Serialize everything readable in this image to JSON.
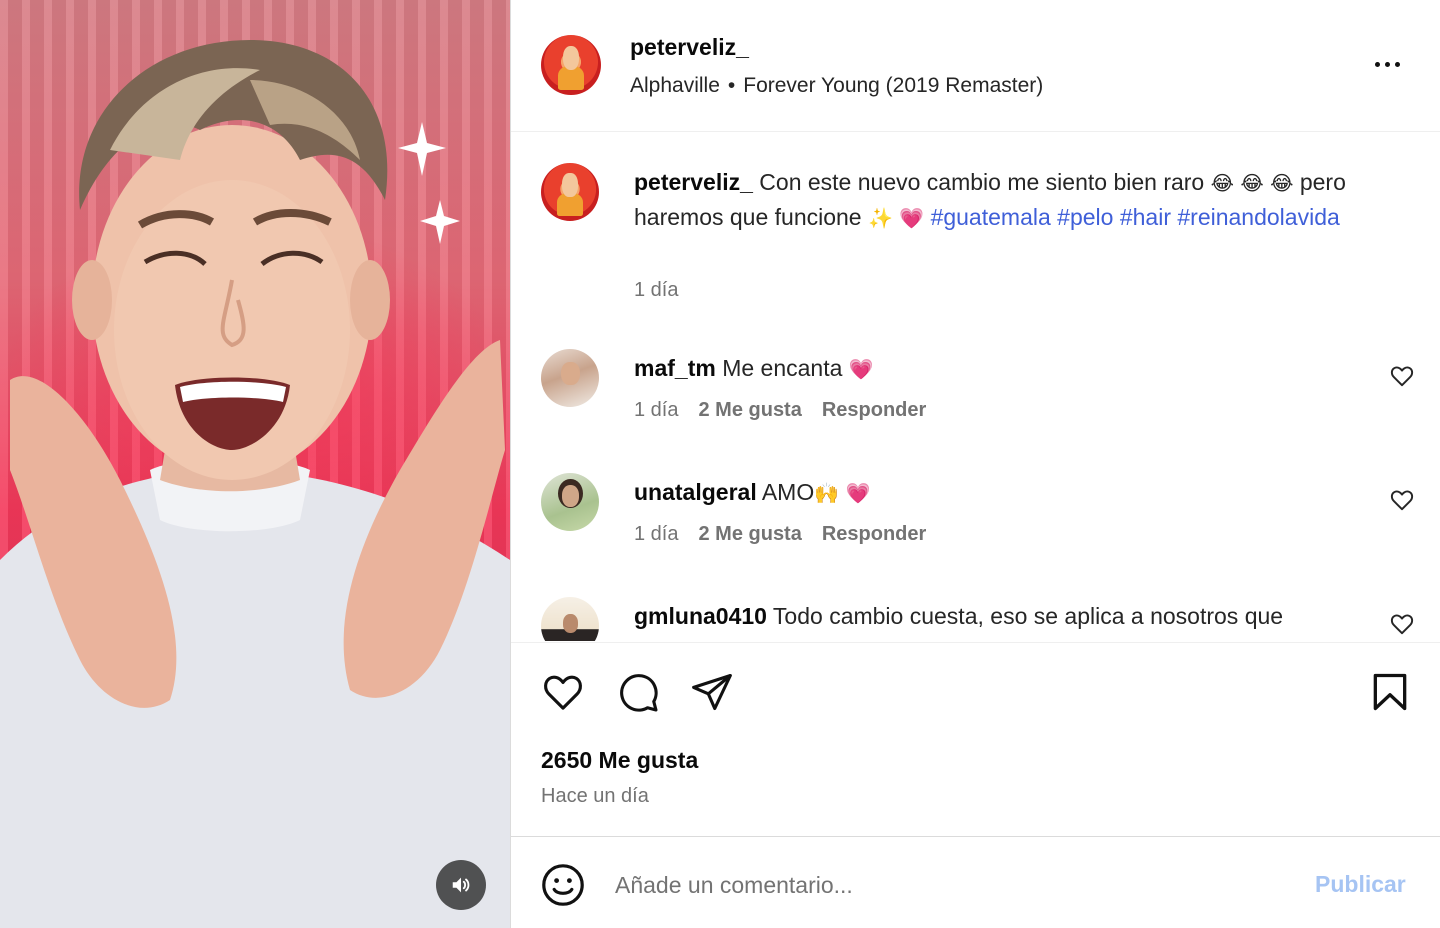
{
  "post": {
    "username": "peterveliz_",
    "music_artist": "Alphaville",
    "music_separator": "•",
    "music_track": "Forever Young (2019 Remaster)"
  },
  "caption": {
    "username": "peterveliz_",
    "text_part1": " Con este nuevo cambio me siento bien raro ",
    "emoji_laugh": "😂 😂 😂",
    "text_part2": " pero haremos que funcione ",
    "emoji_sparkles_heart": "✨ 💗",
    "hashtags": [
      "#guatemala",
      "#pelo",
      "#hair",
      "#reinandolavida"
    ],
    "time": "1 día"
  },
  "comments": [
    {
      "username": "maf_tm",
      "text": " Me encanta ",
      "emoji": "💗",
      "time": "1 día",
      "likes": "2 Me gusta",
      "reply": "Responder"
    },
    {
      "username": "unatalgeral",
      "text": " AMO",
      "emoji": "🙌 💗",
      "time": "1 día",
      "likes": "2 Me gusta",
      "reply": "Responder"
    },
    {
      "username": "gmluna0410",
      "text": " Todo cambio cuesta, eso se aplica a nosotros que",
      "emoji": "",
      "time": "",
      "likes": "",
      "reply": ""
    }
  ],
  "stats": {
    "likes": "2650 Me gusta",
    "posted": "Hace un día"
  },
  "composer": {
    "placeholder": "Añade un comentario...",
    "publish_label": "Publicar"
  },
  "icons": {
    "more": "more-options-icon",
    "like": "heart-icon",
    "comment": "comment-icon",
    "share": "share-icon",
    "save": "bookmark-icon",
    "emoji": "emoji-icon",
    "sound": "speaker-icon"
  },
  "colors": {
    "hashtag": "#3f5fd8",
    "publish_disabled": "#a6c4f3",
    "muted_text": "#737373"
  }
}
